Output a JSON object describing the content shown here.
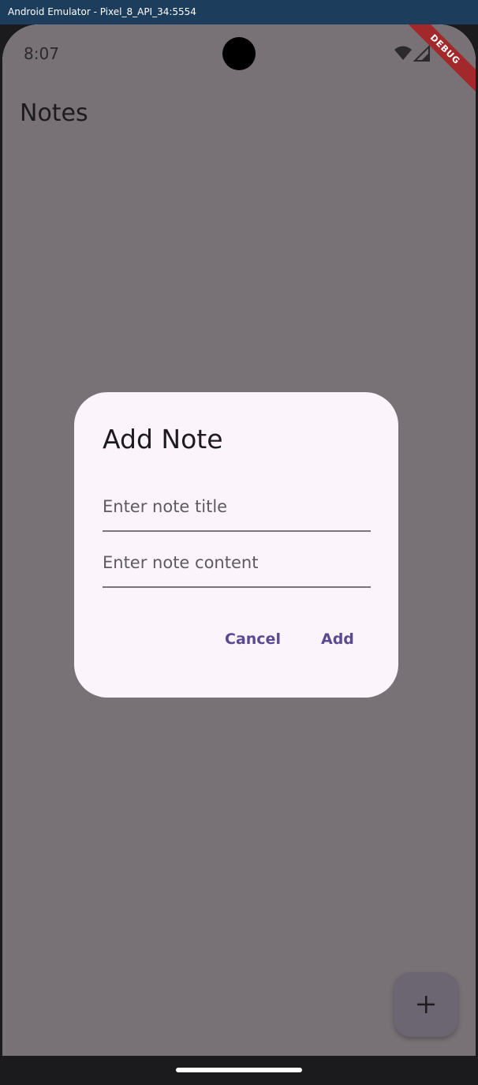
{
  "window": {
    "title": "Android Emulator - Pixel_8_API_34:5554"
  },
  "status_bar": {
    "time": "8:07",
    "icons": [
      "wifi-icon",
      "cell-signal-icon"
    ]
  },
  "debug_banner": "DEBUG",
  "app_bar": {
    "title": "Notes"
  },
  "dialog": {
    "title": "Add Note",
    "title_field": {
      "placeholder": "Enter note title",
      "value": ""
    },
    "content_field": {
      "placeholder": "Enter note content",
      "value": ""
    },
    "cancel_label": "Cancel",
    "add_label": "Add"
  },
  "fab": {
    "icon": "plus-icon"
  },
  "colors": {
    "accent": "#5b4a90",
    "scrim": "#787276",
    "dialog_surface": "#fcf4fb",
    "debug_banner": "#a3282b"
  }
}
